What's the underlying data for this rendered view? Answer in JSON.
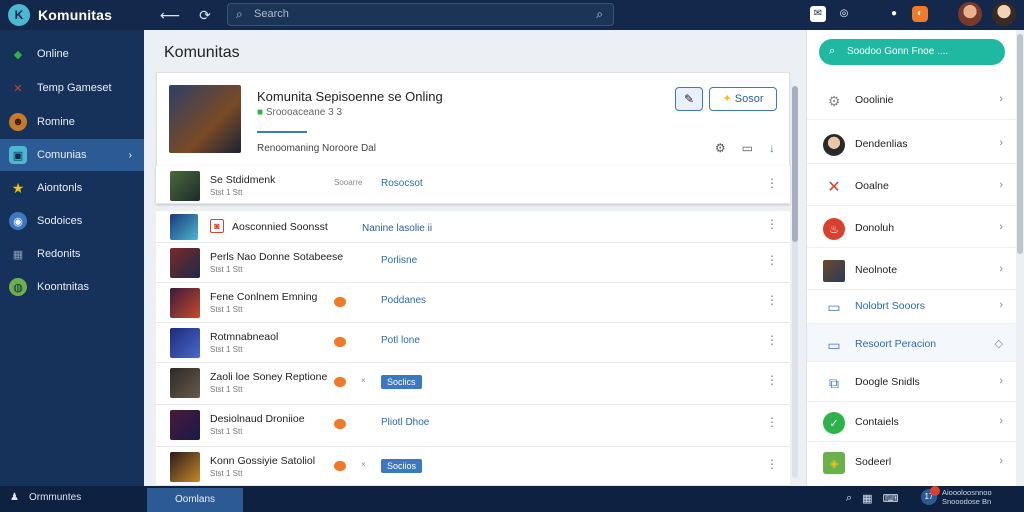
{
  "app": {
    "title": "Komunitas",
    "logo_letter": "K"
  },
  "topbar": {
    "search_placeholder": "Search",
    "icons": [
      "back-icon",
      "refresh-icon",
      "chat-icon",
      "messenger-icon",
      "steam-icon",
      "orange-icon"
    ]
  },
  "sidebar": {
    "items": [
      {
        "label": "Online",
        "icon": "gem-icon",
        "color": "#2db34a"
      },
      {
        "label": "Temp Gameset",
        "icon": "swords-icon",
        "color": "#d9412f"
      },
      {
        "label": "Romine",
        "icon": "face-icon",
        "color": "#c77a2a"
      },
      {
        "label": "Comunias",
        "icon": "controller-icon",
        "color": "#4db6d0",
        "active": true
      },
      {
        "label": "Aiontonls",
        "icon": "star-icon",
        "color": "#f2c21b"
      },
      {
        "label": "Sodoices",
        "icon": "globe-icon",
        "color": "#3a78c2"
      },
      {
        "label": "Redonits",
        "icon": "grid-icon",
        "color": "#8a9bb5"
      },
      {
        "label": "Koontnitas",
        "icon": "earth-icon",
        "color": "#6ab04c"
      }
    ]
  },
  "main": {
    "title": "Komunitas",
    "card": {
      "title": "Komunita Sepisoenne se Onling",
      "subtitle": "Sroooaceane 3 3",
      "actions": "Renoomaning   Noroore   Dal",
      "button_label": "Sosor"
    },
    "rows": [
      {
        "title": "Se Stdidmenk",
        "meta": "Stst 1 Stt",
        "tag": "Rosocsot",
        "left_meta": "Sooarre",
        "style": "tag"
      },
      {
        "title": "Aosconnied Soonsst",
        "meta": "",
        "tag": "Nanine lasolie ii",
        "style": "tag2"
      },
      {
        "title": "Perls Nao Donne Sotabeese",
        "meta": "Stst 1 Stt",
        "tag": "Porlisne",
        "style": "tag"
      },
      {
        "title": "Fene Conlnem Emning",
        "meta": "Stst 1 Stt",
        "tag": "Poddanes",
        "style": "dot"
      },
      {
        "title": "Rotmnabneaol",
        "meta": "Stst 1 Stt",
        "tag": "Potl lone",
        "style": "dot"
      },
      {
        "title": "Zaoli loe Soney Reptione",
        "meta": "Stst 1 Stt",
        "tag": "Soclics",
        "style": "pill"
      },
      {
        "title": "Desiolnaud Droniioe",
        "meta": "Stst 1 Stt",
        "tag": "Pliotl Dhoe",
        "style": "dot"
      },
      {
        "title": "Konn Gossiyie Satoliol",
        "meta": "Stst 1 Stt",
        "tag": "Sociios",
        "style": "pill"
      }
    ]
  },
  "right_panel": {
    "search_text": "Soodoo Gonn Fnoe ....",
    "items": [
      {
        "label": "Ooolinie",
        "icon": "cog-icon",
        "color": "#888"
      },
      {
        "label": "Dendenlias",
        "icon": "avatar-icon",
        "color": "#333"
      },
      {
        "label": "Ooalne",
        "icon": "swords-icon",
        "color": "#d9412f"
      },
      {
        "label": "Donoluh",
        "icon": "fire-icon",
        "color": "#d9412f"
      },
      {
        "label": "Neolnote",
        "icon": "image-icon",
        "color": "#6b4a2a"
      },
      {
        "label": "Nolobrt Sooors",
        "icon": "window-icon",
        "color": "#3a78c2",
        "blue": true
      },
      {
        "label": "Resoort Peracion",
        "icon": "monitor-icon",
        "color": "#3a78c2",
        "blue": true,
        "highlight": true
      },
      {
        "label": "Doogle Snidls",
        "icon": "puzzle-icon",
        "color": "#3a78c2"
      },
      {
        "label": "Contaiels",
        "icon": "check-icon",
        "color": "#2db34a"
      },
      {
        "label": "Sodeerl",
        "icon": "cube-icon",
        "color": "#6ab04c"
      }
    ]
  },
  "bottombar": {
    "left_label": "Ormmuntes",
    "tab_label": "Oomlans",
    "notification_count": "17",
    "notification_text": "Aioooloosnnoo Snooodose Bn"
  }
}
